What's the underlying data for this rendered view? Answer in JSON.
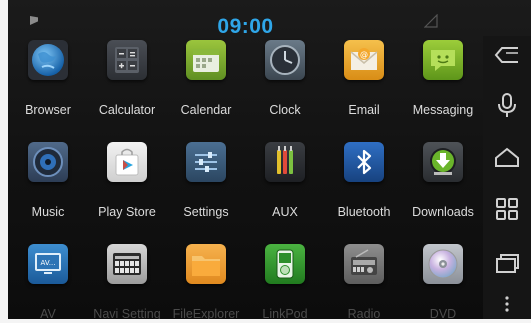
{
  "status_bar": {
    "time": "09:00",
    "time_color": "#2fa6e8",
    "notification_icon": "flag-icon",
    "signal_icon": "signal-icon"
  },
  "apps": [
    {
      "label": "Browser",
      "icon": "globe-icon"
    },
    {
      "label": "Calculator",
      "icon": "calculator-icon"
    },
    {
      "label": "Calendar",
      "icon": "calendar-icon"
    },
    {
      "label": "Clock",
      "icon": "clock-icon"
    },
    {
      "label": "Email",
      "icon": "envelope-icon"
    },
    {
      "label": "Messaging",
      "icon": "speech-bubble-icon"
    },
    {
      "label": "Music",
      "icon": "speaker-icon"
    },
    {
      "label": "Play Store",
      "icon": "shopping-bag-icon"
    },
    {
      "label": "Settings",
      "icon": "sliders-icon"
    },
    {
      "label": "AUX",
      "icon": "aux-cables-icon"
    },
    {
      "label": "Bluetooth",
      "icon": "bluetooth-icon"
    },
    {
      "label": "Downloads",
      "icon": "download-icon"
    },
    {
      "label": "AV",
      "icon": "tv-icon"
    },
    {
      "label": "Navi Setting",
      "icon": "navi-screen-icon"
    },
    {
      "label": "FileExplorer",
      "icon": "folder-icon"
    },
    {
      "label": "LinkPod",
      "icon": "music-player-icon"
    },
    {
      "label": "Radio",
      "icon": "radio-icon"
    },
    {
      "label": "DVD",
      "icon": "disc-icon"
    }
  ],
  "nav": [
    {
      "icon": "back-icon"
    },
    {
      "icon": "microphone-icon"
    },
    {
      "icon": "home-icon"
    },
    {
      "icon": "apps-grid-icon"
    },
    {
      "icon": "recent-apps-icon"
    },
    {
      "icon": "overflow-menu-icon"
    }
  ]
}
